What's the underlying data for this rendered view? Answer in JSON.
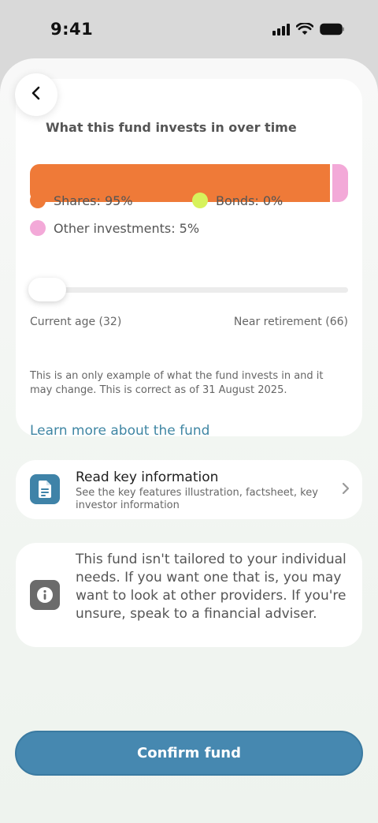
{
  "status_bar": {
    "time": "9:41"
  },
  "fund_card": {
    "title": "What this fund invests in over time",
    "allocation": [
      {
        "name": "Shares",
        "percent": 95,
        "color": "#ef7a38"
      },
      {
        "name": "Bonds",
        "percent": 0,
        "color": "#d7f25c"
      },
      {
        "name": "Other investments",
        "percent": 5,
        "color": "#f3a9d8"
      }
    ],
    "legend": {
      "shares": "Shares: 95%",
      "bonds": "Bonds: 0%",
      "other": "Other investments: 5%"
    },
    "slider": {
      "start_label": "Current age (32)",
      "end_label": "Near retirement (66)",
      "position": 0
    },
    "disclaimer": "This is an only example of what the fund invests in and it may change. This is correct as of 31 August 2025.",
    "learn_more": "Learn more about the fund"
  },
  "key_info": {
    "title": "Read key information",
    "subtitle": "See the key features illustration, factsheet, key investor information",
    "icon": "document-icon"
  },
  "info_notice": {
    "text": "This fund isn't tailored to your individual needs. If you want one that is, you may want to look at other providers. If you're unsure, speak to a financial adviser.",
    "icon": "info-icon"
  },
  "confirm_button": {
    "label": "Confirm fund"
  },
  "colors": {
    "accent": "#4688b0",
    "link": "#3f86a3"
  }
}
